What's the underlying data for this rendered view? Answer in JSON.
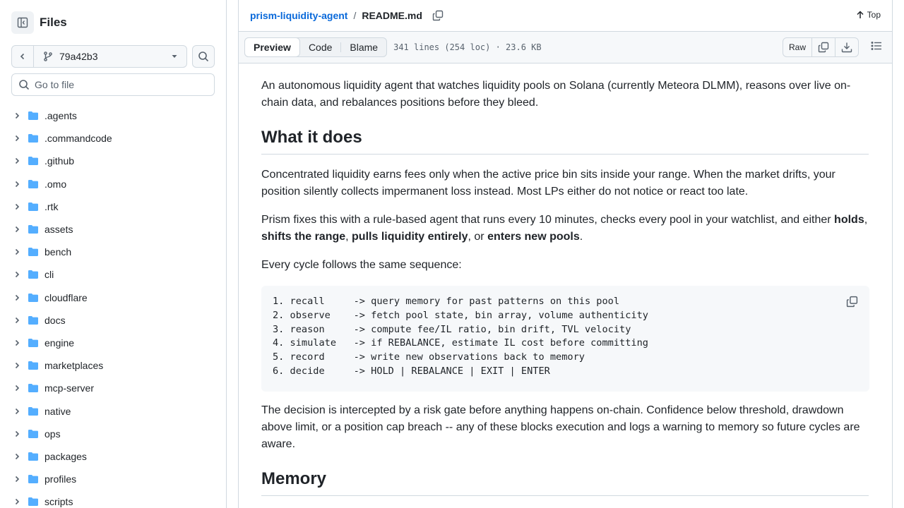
{
  "sidebar": {
    "title": "Files",
    "branch": "79a42b3",
    "goto_placeholder": "Go to file",
    "items": [
      {
        "label": ".agents"
      },
      {
        "label": ".commandcode"
      },
      {
        "label": ".github"
      },
      {
        "label": ".omo"
      },
      {
        "label": ".rtk"
      },
      {
        "label": "assets"
      },
      {
        "label": "bench"
      },
      {
        "label": "cli"
      },
      {
        "label": "cloudflare"
      },
      {
        "label": "docs"
      },
      {
        "label": "engine"
      },
      {
        "label": "marketplaces"
      },
      {
        "label": "mcp-server"
      },
      {
        "label": "native"
      },
      {
        "label": "ops"
      },
      {
        "label": "packages"
      },
      {
        "label": "profiles"
      },
      {
        "label": "scripts"
      }
    ]
  },
  "breadcrumb": {
    "repo": "prism-liquidity-agent",
    "separator": "/",
    "file": "README.md"
  },
  "top_link": "Top",
  "filebar": {
    "tabs": [
      "Preview",
      "Code",
      "Blame"
    ],
    "meta": "341 lines (254 loc) · 23.6 KB",
    "raw_label": "Raw"
  },
  "readme": {
    "intro": "An autonomous liquidity agent that watches liquidity pools on Solana (currently Meteora DLMM), reasons over live on-chain data, and rebalances positions before they bleed.",
    "h_what": "What it does",
    "p1": "Concentrated liquidity earns fees only when the active price bin sits inside your range. When the market drifts, your position silently collects impermanent loss instead. Most LPs either do not notice or react too late.",
    "p2_start": "Prism fixes this with a rule-based agent that runs every 10 minutes, checks every pool in your watchlist, and either ",
    "p2_holds": "holds",
    "p2_c1": ", ",
    "p2_shifts": "shifts the range",
    "p2_c2": ", ",
    "p2_pulls": "pulls liquidity entirely",
    "p2_or": ", or ",
    "p2_enters": "enters new pools",
    "p2_end": ".",
    "p3": "Every cycle follows the same sequence:",
    "code": [
      "1. recall     -> query memory for past patterns on this pool",
      "2. observe    -> fetch pool state, bin array, volume authenticity",
      "3. reason     -> compute fee/IL ratio, bin drift, TVL velocity",
      "4. simulate   -> if REBALANCE, estimate IL cost before committing",
      "5. record     -> write new observations back to memory",
      "6. decide     -> HOLD | REBALANCE | EXIT | ENTER"
    ],
    "p4": "The decision is intercepted by a risk gate before anything happens on-chain. Confidence below threshold, drawdown above limit, or a position cap breach -- any of these blocks execution and logs a warning to memory so future cycles are aware.",
    "h_memory": "Memory"
  },
  "colors": {
    "link": "#0969da",
    "folder": "#54aeff",
    "border": "#d1d9e0",
    "muted": "#59636e"
  }
}
